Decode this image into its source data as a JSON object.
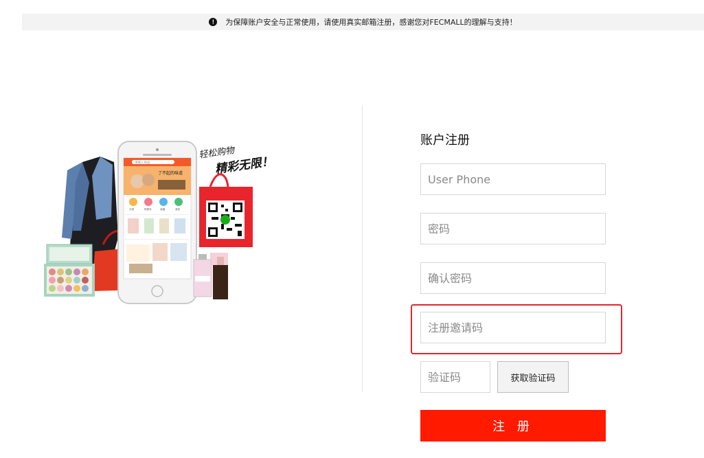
{
  "notice": {
    "icon": "exclamation-circle-icon",
    "text": "为保障账户安全与正常使用，请使用真实邮箱注册，感谢您对FECMALL的理解与支持！"
  },
  "promo": {
    "slogan_line1": "轻松购物",
    "slogan_line2": "精彩无限！",
    "phone_search_placeholder": "请输入商品",
    "phone_banner_text": "了不起的味道",
    "phone_categories": [
      "分类",
      "购物车",
      "收藏",
      "我的"
    ],
    "accent_color": "#f25a2a"
  },
  "form": {
    "title": "账户注册",
    "phone_placeholder": "User Phone",
    "password_placeholder": "密码",
    "confirm_password_placeholder": "确认密码",
    "invite_code_placeholder": "注册邀请码",
    "captcha_placeholder": "验证码",
    "get_code_label": "获取验证码",
    "submit_label": "注 册",
    "submit_color": "#ff1a00",
    "highlight_color": "#e0262b"
  }
}
